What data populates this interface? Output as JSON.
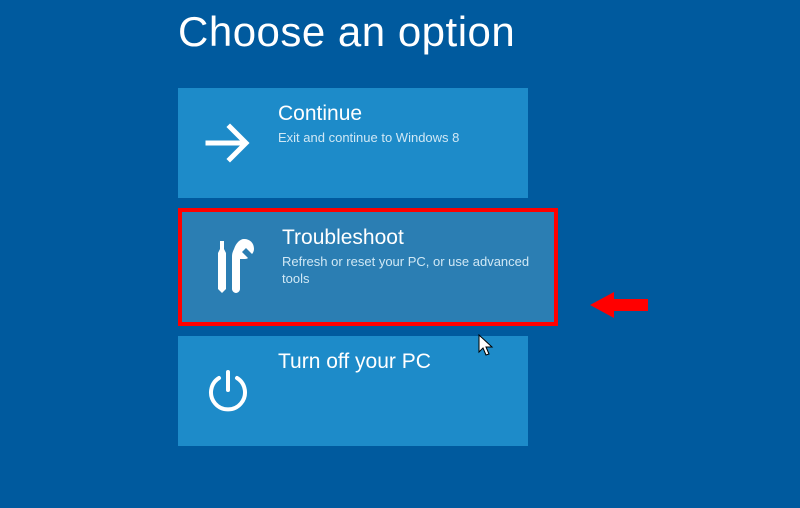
{
  "title": "Choose an option",
  "options": [
    {
      "title": "Continue",
      "desc": "Exit and continue to Windows 8",
      "icon": "arrow-right"
    },
    {
      "title": "Troubleshoot",
      "desc": "Refresh or reset your PC, or use advanced tools",
      "icon": "tools",
      "highlighted": true
    },
    {
      "title": "Turn off your PC",
      "desc": "",
      "icon": "power"
    }
  ],
  "colors": {
    "background": "#005a9e",
    "tile": "#1d8bc9",
    "tile_hover": "#2b7eb3",
    "annotation": "#ff0000"
  }
}
